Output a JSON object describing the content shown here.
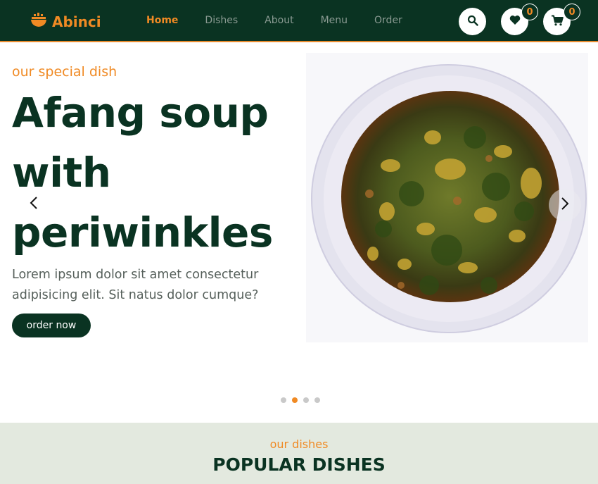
{
  "brand": {
    "name": "Abinci",
    "icon": "ship-bowl-icon",
    "color": "#f08a24"
  },
  "nav": {
    "items": [
      {
        "label": "Home",
        "active": true
      },
      {
        "label": "Dishes",
        "active": false
      },
      {
        "label": "About",
        "active": false
      },
      {
        "label": "Menu",
        "active": false
      },
      {
        "label": "Order",
        "active": false
      }
    ]
  },
  "actions": {
    "search_icon": "search-icon",
    "wishlist": {
      "icon": "heart-icon",
      "count": "0"
    },
    "cart": {
      "icon": "cart-icon",
      "count": "0"
    }
  },
  "hero": {
    "subtitle": "our special dish",
    "title": "Afang soup with periwinkles",
    "description": "Lorem ipsum dolor sit amet consectetur adipisicing elit. Sit natus dolor cumque?",
    "button": "order now",
    "slides_total": 4,
    "active_slide": 2
  },
  "section": {
    "subtitle": "our dishes",
    "title": "POPULAR DISHES"
  },
  "colors": {
    "primary": "#0a3322",
    "accent": "#f08a24",
    "section_bg": "#e3e9df"
  }
}
